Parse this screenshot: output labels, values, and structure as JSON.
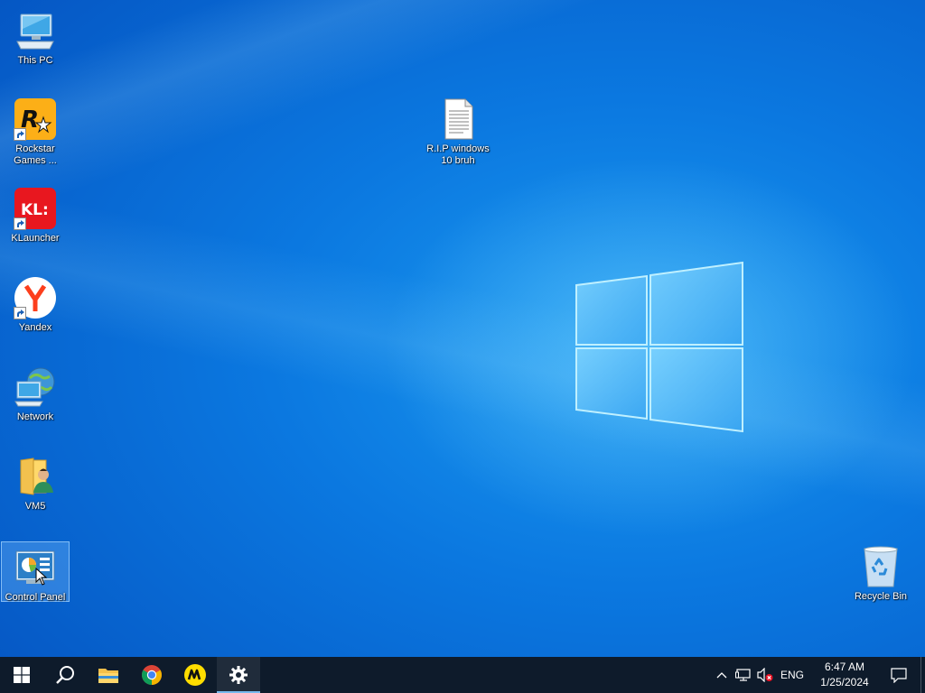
{
  "desktop": {
    "icons": [
      {
        "label": "This PC",
        "icon": "this-pc-icon"
      },
      {
        "label": "Rockstar\nGames ...",
        "icon": "rockstar-games-icon"
      },
      {
        "label": "KLauncher",
        "icon": "klauncher-icon"
      },
      {
        "label": "Yandex",
        "icon": "yandex-icon"
      },
      {
        "label": "Network",
        "icon": "network-icon"
      },
      {
        "label": "VM5",
        "icon": "user-folder-icon"
      },
      {
        "label": "Control Panel",
        "icon": "control-panel-icon",
        "selected": true
      },
      {
        "label": "R.I.P windows\n10 bruh",
        "icon": "text-document-icon"
      },
      {
        "label": "Recycle Bin",
        "icon": "recycle-bin-icon"
      }
    ],
    "klauncher_logo_text": "KL:",
    "rockstar_logo_text": "R"
  },
  "taskbar": {
    "pinned": [
      {
        "name": "start",
        "icon": "windows-start-icon"
      },
      {
        "name": "search",
        "icon": "search-icon"
      },
      {
        "name": "file-explorer",
        "icon": "folder-icon"
      },
      {
        "name": "chrome",
        "icon": "chrome-icon"
      },
      {
        "name": "yandex-market",
        "icon": "yandex-market-icon"
      },
      {
        "name": "settings",
        "icon": "gear-icon",
        "active": true
      }
    ],
    "tray": {
      "language": "ENG",
      "time": "6:47 AM",
      "date": "1/25/2024"
    }
  },
  "colors": {
    "taskbar_bg": "#0e1b2b",
    "active_indicator": "#76b9ed",
    "wallpaper_blue": "#0b78e0"
  }
}
